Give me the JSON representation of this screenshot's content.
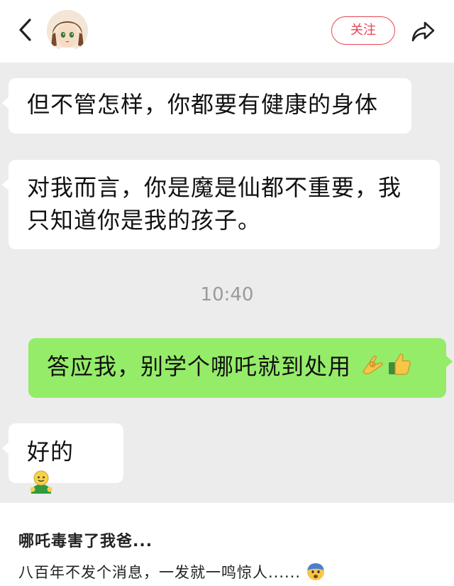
{
  "header": {
    "follow_label": "关注",
    "back_icon": "chevron-left-icon",
    "share_icon": "share-arrow-icon",
    "accent_color": "#e64652"
  },
  "chat": {
    "background": "#ececec",
    "messages": [
      {
        "side": "left",
        "text": "但不管怎样，你都要有健康的身体"
      },
      {
        "side": "left",
        "text": "对我而言，你是魔是仙都不重要，我只知道你是我的孩子。"
      },
      {
        "side": "right",
        "text": "答应我，别学个哪吒就到处用",
        "emojis": [
          "ok-hand-emoji",
          "thumbs-up-emoji"
        ]
      },
      {
        "side": "left",
        "text": "好的",
        "emojis": [
          "smiling-person-emoji"
        ]
      }
    ],
    "timestamp": "10:40",
    "sent_bubble_color": "#95ec69"
  },
  "post": {
    "title": "哪吒毒害了我爸...",
    "subtitle": "八百年不发个消息，一发就一鸣惊人......",
    "subtitle_emoji": "fearful-face-emoji"
  }
}
